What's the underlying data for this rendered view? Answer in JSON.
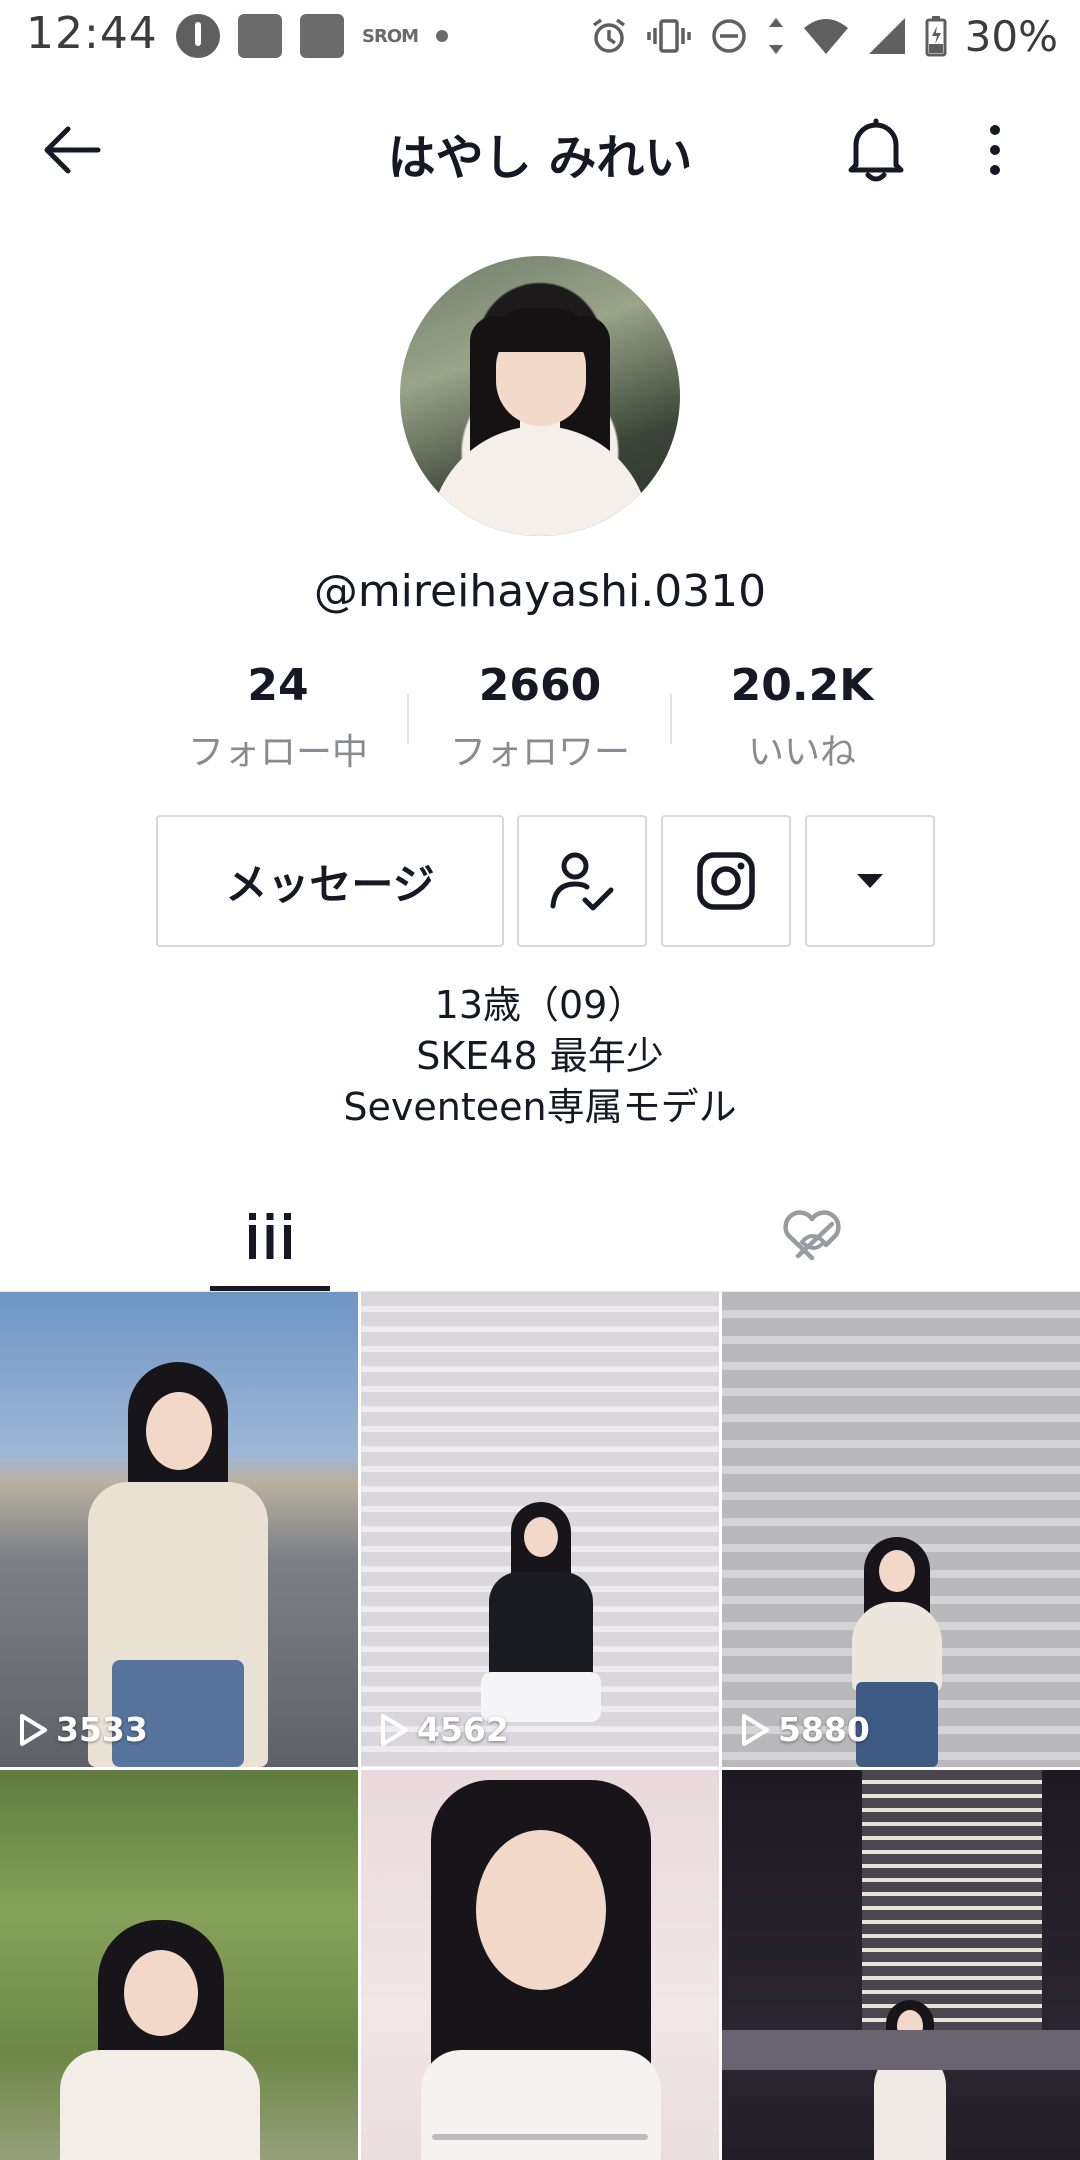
{
  "status_bar": {
    "time": "12:44",
    "brand_icon_text": "SROM",
    "battery": "30%",
    "icons": [
      "thermometer-icon",
      "square-icon",
      "square-icon",
      "dot-icon",
      "alarm-icon",
      "vibrate-icon",
      "dnd-icon",
      "data-arrows-icon",
      "wifi-icon",
      "signal-icon",
      "battery-charging-icon"
    ]
  },
  "header": {
    "title": "はやし みれい",
    "back_icon": "arrow-left-icon",
    "bell_icon": "bell-icon",
    "more_icon": "more-vertical-icon"
  },
  "profile": {
    "username": "@mireihayashi.0310",
    "avatar_icon": "avatar-photo"
  },
  "stats": [
    {
      "value": "24",
      "label": "フォロー中"
    },
    {
      "value": "2660",
      "label": "フォロワー"
    },
    {
      "value": "20.2K",
      "label": "いいね"
    }
  ],
  "actions": {
    "message_label": "メッセージ",
    "following_icon": "user-check-icon",
    "instagram_icon": "instagram-icon",
    "dropdown_icon": "caret-down-icon"
  },
  "bio": {
    "line1": "13歳（09）",
    "line2": "SKE48 最年少",
    "line3": "Seventeen専属モデル"
  },
  "tabs": [
    {
      "name": "videos",
      "icon": "grid-columns-icon",
      "active": true
    },
    {
      "name": "liked",
      "icon": "hidden-heart-icon",
      "active": false
    }
  ],
  "videos": [
    {
      "views": "3533"
    },
    {
      "views": "4562"
    },
    {
      "views": "5880"
    },
    {
      "views": ""
    },
    {
      "views": ""
    },
    {
      "views": ""
    }
  ],
  "colors": {
    "text_primary": "#161823",
    "text_secondary": "#8a8b91",
    "border": "#d8d8da"
  }
}
